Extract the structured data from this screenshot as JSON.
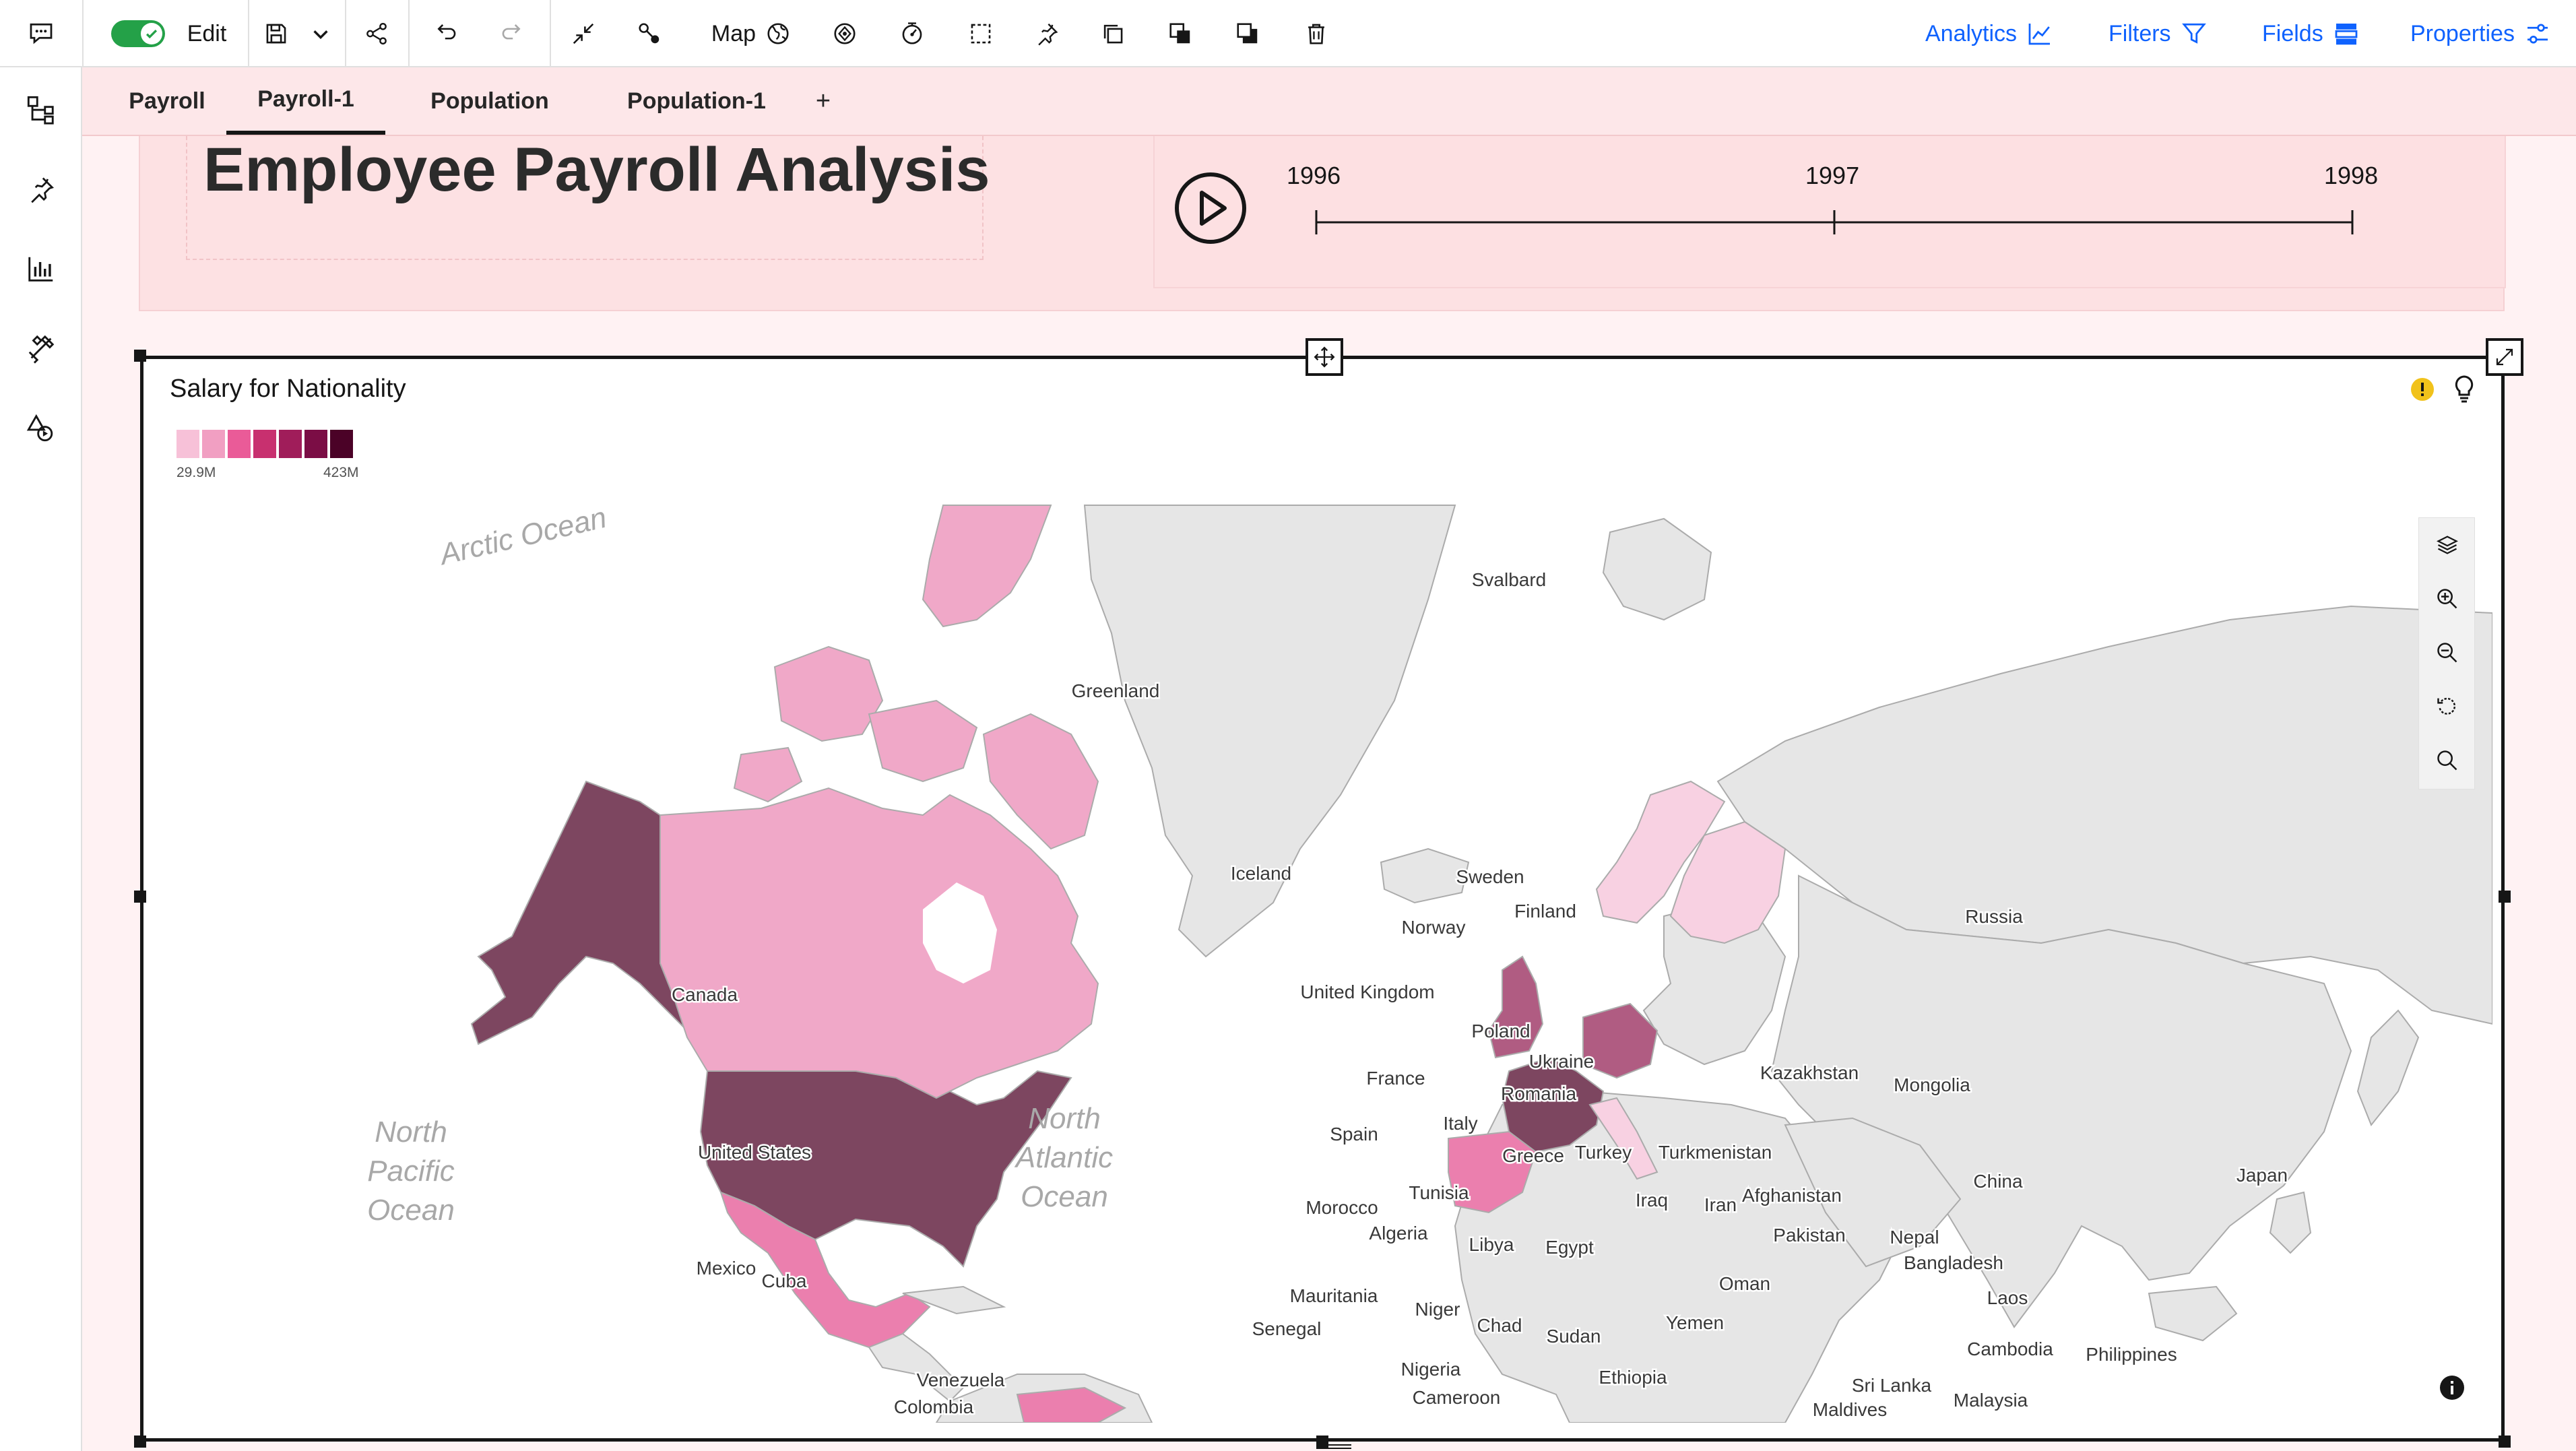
{
  "toolbar": {
    "edit_label": "Edit",
    "map_label": "Map",
    "analytics_label": "Analytics",
    "filters_label": "Filters",
    "fields_label": "Fields",
    "properties_label": "Properties",
    "edit_mode_on": true
  },
  "tabs": [
    {
      "label": "Payroll",
      "active": false
    },
    {
      "label": "Payroll-1",
      "active": true
    },
    {
      "label": "Population",
      "active": false
    },
    {
      "label": "Population-1",
      "active": false
    }
  ],
  "add_tab_label": "+",
  "dashboard": {
    "title": "Employee Payroll Analysis",
    "timeline_years": [
      "1996",
      "1997",
      "1998"
    ]
  },
  "widget": {
    "title": "Salary for Nationality",
    "legend_min": "29.9M",
    "legend_max": "423M",
    "legend_colors": [
      "#f7c1d8",
      "#f19fc2",
      "#ea5b98",
      "#c8306f",
      "#a01d5a",
      "#7b0d45",
      "#4b0227"
    ]
  },
  "map": {
    "colors": {
      "ocean": "#ffffff",
      "land_no_data": "#e6e6e6",
      "border": "#ababab",
      "high": "#7d4660",
      "mid_high": "#b05c82",
      "mid": "#eb7fae",
      "low": "#f0a8c8",
      "lowest": "#f8d1e2"
    },
    "ocean_labels": [
      "Arctic Ocean",
      "North Pacific Ocean",
      "North Atlantic Ocean"
    ],
    "country_labels": [
      "Svalbard",
      "Greenland",
      "Iceland",
      "Sweden",
      "Finland",
      "Norway",
      "Russia",
      "United Kingdom",
      "Poland",
      "Canada",
      "Ukraine",
      "Kazakhstan",
      "Mongolia",
      "France",
      "Romania",
      "Italy",
      "Spain",
      "Greece",
      "Turkey",
      "Turkmenistan",
      "Afghanistan",
      "United States",
      "China",
      "Japan",
      "Tunisia",
      "Iraq",
      "Iran",
      "Pakistan",
      "Morocco",
      "Algeria",
      "Libya",
      "Egypt",
      "Nepal",
      "Bangladesh",
      "Mexico",
      "Cuba",
      "Oman",
      "Mauritania",
      "Niger",
      "Chad",
      "Sudan",
      "Yemen",
      "Laos",
      "Senegal",
      "Cambodia",
      "Philippines",
      "Nigeria",
      "Ethiopia",
      "Venezuela",
      "Sri Lanka",
      "Cameroon",
      "Malaysia",
      "Colombia",
      "Maldives"
    ]
  }
}
